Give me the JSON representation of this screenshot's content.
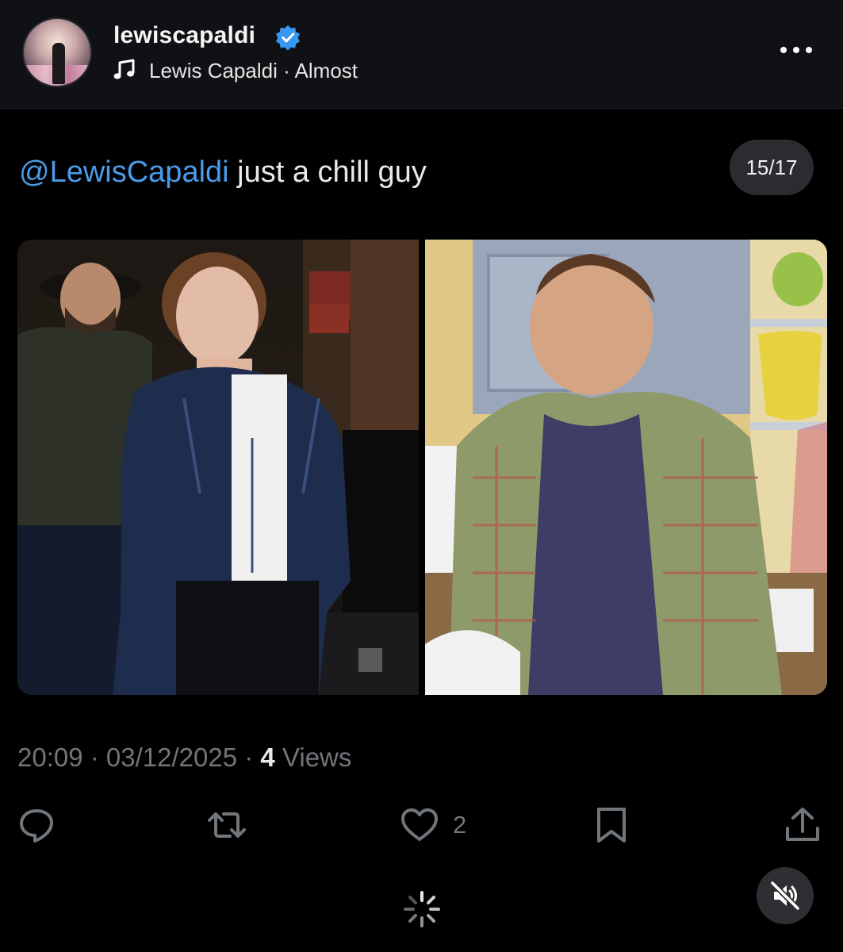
{
  "header": {
    "username": "lewiscapaldi",
    "verified_icon": "verified-badge-icon",
    "music_icon": "music-note-icon",
    "music_text": "Lewis Capaldi · Almost",
    "more_icon": "more-options-icon"
  },
  "post": {
    "mention": "@LewisCapaldi",
    "text": " just a chill guy",
    "counter": "15/17",
    "images": [
      "photo-left",
      "photo-right"
    ],
    "time": "20:09",
    "date": "03/12/2025",
    "views_count": "4",
    "views_label": "Views",
    "separator": " · "
  },
  "actions": {
    "reply_icon": "reply-icon",
    "retweet_icon": "retweet-icon",
    "like_icon": "heart-icon",
    "like_count": "2",
    "bookmark_icon": "bookmark-icon",
    "share_icon": "share-icon"
  },
  "overlay": {
    "loading_icon": "loading-spinner-icon",
    "mute_icon": "speaker-muted-icon"
  },
  "colors": {
    "mention": "#4a9be8",
    "secondary_text": "#71767b",
    "verified": "#3897f0",
    "badge_bg": "#2b2c30"
  }
}
